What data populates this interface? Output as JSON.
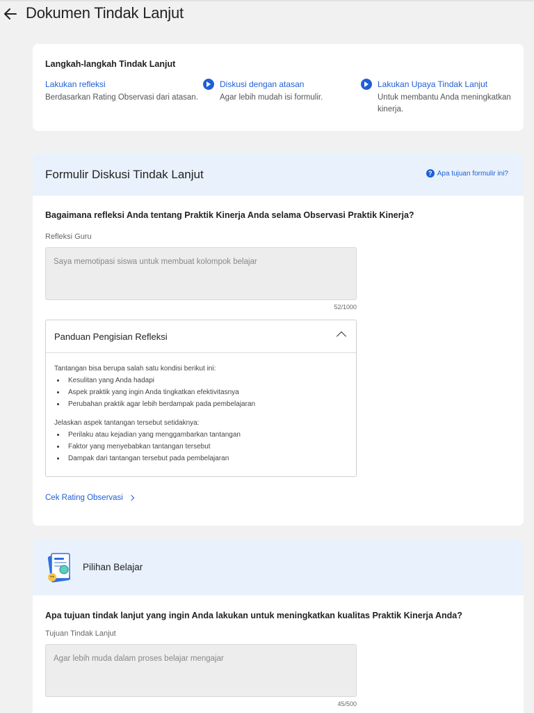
{
  "header": {
    "title": "Dokumen Tindak Lanjut"
  },
  "steps": {
    "title": "Langkah-langkah Tindak Lanjut",
    "items": [
      {
        "label": "Lakukan refleksi",
        "desc": "Berdasarkan Rating Observasi dari atasan."
      },
      {
        "label": "Diskusi dengan atasan",
        "desc": "Agar lebih mudah isi formulir."
      },
      {
        "label": "Lakukan Upaya Tindak Lanjut",
        "desc": "Untuk membantu Anda meningkatkan kinerja."
      }
    ]
  },
  "form": {
    "title": "Formulir Diskusi Tindak Lanjut",
    "help_link": "Apa tujuan formulir ini?",
    "question": "Bagaimana refleksi Anda tentang Praktik Kinerja Anda selama Observasi Praktik Kinerja?",
    "field_label": "Refleksi Guru",
    "field_value": "Saya memotipasi siswa untuk membuat kolompok belajar",
    "counter": "52/1000",
    "guide": {
      "title": "Panduan Pengisian Refleksi",
      "intro1": "Tantangan bisa berupa salah satu kondisi berikut ini:",
      "list1": [
        "Kesulitan yang Anda hadapi",
        "Aspek praktik yang ingin Anda tingkatkan efektivitasnya",
        "Perubahan praktik agar lebih berdampak pada pembelajaran"
      ],
      "intro2": "Jelaskan aspek tantangan tersebut setidaknya:",
      "list2": [
        "Perilaku atau kejadian yang menggambarkan tantangan",
        "Faktor yang menyebabkan tantangan tersebut",
        "Dampak dari tantangan tersebut pada pembelajaran"
      ]
    },
    "cek_link": "Cek Rating Observasi"
  },
  "learning": {
    "title": "Pilihan Belajar",
    "question": "Apa tujuan tindak lanjut yang ingin Anda lakukan untuk meningkatkan kualitas Praktik Kinerja Anda?",
    "field_label": "Tujuan Tindak Lanjut",
    "field_value": "Agar lebih muda dalam proses belajar mengajar",
    "counter": "45/500"
  },
  "colors": {
    "accent": "#1f5fd6",
    "header_tint": "#e9f2fc",
    "background": "#f1f1f1"
  },
  "icons": {
    "back": "arrow-left-icon",
    "step": "play-circle-icon",
    "help": "question-circle-icon",
    "guide_toggle": "chevron-up-icon",
    "cek": "chevron-right-icon",
    "learning": "document-certificate-icon"
  }
}
